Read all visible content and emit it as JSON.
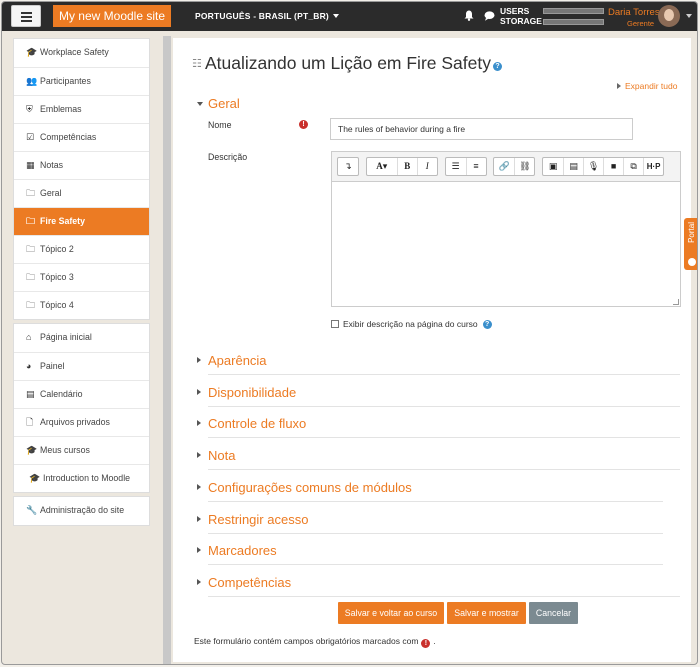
{
  "navbar": {
    "site_name": "My new Moodle site",
    "language": "PORTUGUÊS - BRASIL (PT_BR)",
    "storage_label_1": "USERS",
    "storage_label_2": "STORAGE",
    "user_name": "Daria Torres",
    "user_role": "Gerente"
  },
  "sidebar": {
    "course_items": [
      {
        "icon": "graduation-cap-icon",
        "label": "Workplace Safety"
      },
      {
        "icon": "users-icon",
        "label": "Participantes"
      },
      {
        "icon": "shield-icon",
        "label": "Emblemas"
      },
      {
        "icon": "checkbox-icon",
        "label": "Competências"
      },
      {
        "icon": "table-icon",
        "label": "Notas"
      },
      {
        "icon": "folder-icon",
        "label": "Geral"
      },
      {
        "icon": "folder-icon",
        "label": "Fire Safety",
        "active": true
      },
      {
        "icon": "folder-icon",
        "label": "Tópico 2"
      },
      {
        "icon": "folder-icon",
        "label": "Tópico 3"
      },
      {
        "icon": "folder-icon",
        "label": "Tópico 4"
      }
    ],
    "site_items": [
      {
        "icon": "home-icon",
        "label": "Página inicial"
      },
      {
        "icon": "dashboard-icon",
        "label": "Painel"
      },
      {
        "icon": "calendar-icon",
        "label": "Calendário"
      },
      {
        "icon": "file-icon",
        "label": "Arquivos privados"
      },
      {
        "icon": "graduation-cap-icon",
        "label": "Meus cursos"
      },
      {
        "icon": "graduation-cap-icon",
        "label": "Introduction to Moodle"
      }
    ],
    "admin_items": [
      {
        "icon": "wrench-icon",
        "label": "Administração do site"
      }
    ]
  },
  "main": {
    "title": "Atualizando um Lição em Fire Safety",
    "expand_all": "Expandir tudo",
    "sections": {
      "general": "Geral",
      "appearance": "Aparência",
      "availability": "Disponibilidade",
      "flow": "Controle de fluxo",
      "grade": "Nota",
      "common": "Configurações comuns de módulos",
      "restrict": "Restringir acesso",
      "tags": "Marcadores",
      "competencies": "Competências"
    },
    "name_label": "Nome",
    "name_value": "The rules of behavior during a fire",
    "description_label": "Descrição",
    "show_description": "Exibir descrição na página do curso",
    "buttons": {
      "save_return": "Salvar e voltar ao curso",
      "save_show": "Salvar e mostrar",
      "cancel": "Cancelar"
    },
    "required_note": "Este formulário contém campos obrigatórios marcados com",
    "required_note_end": "."
  },
  "portal_label": "Portal",
  "colors": {
    "accent": "#ec7b23",
    "navbar": "#2b2b2b",
    "required": "#c9302c",
    "help": "#3a8fcc"
  }
}
